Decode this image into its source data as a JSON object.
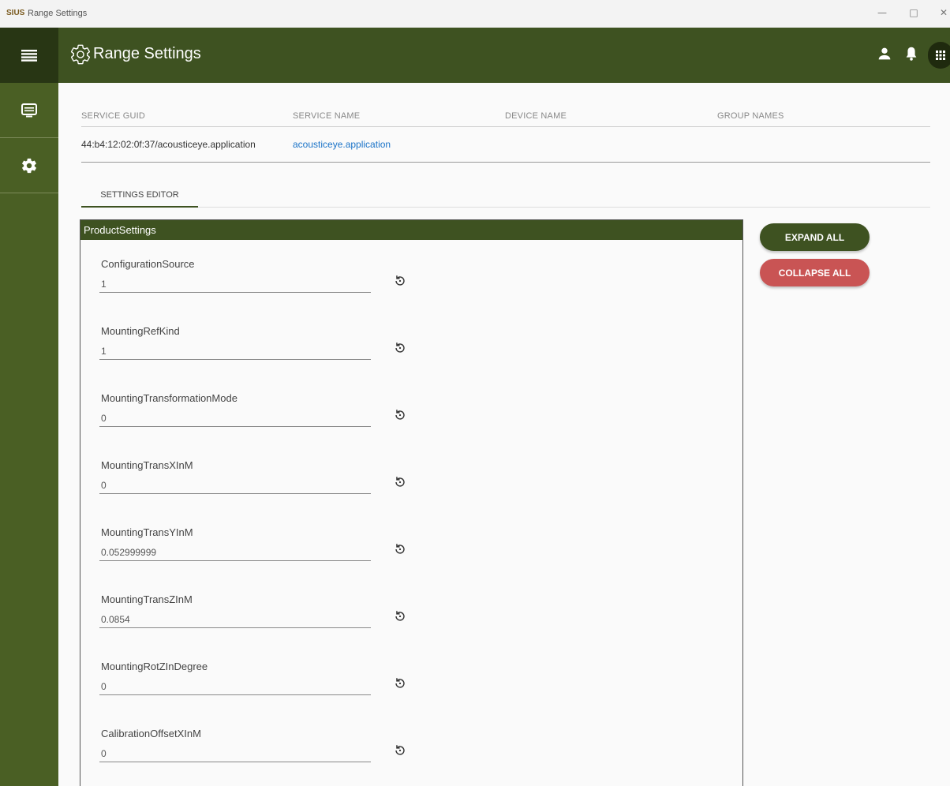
{
  "window": {
    "logo": "SIUS",
    "title": "Range Settings",
    "minimize": "—",
    "maximize": "□",
    "close": "✕"
  },
  "header": {
    "title": "Range Settings"
  },
  "service_table": {
    "columns": [
      "SERVICE GUID",
      "SERVICE NAME",
      "DEVICE NAME",
      "GROUP NAMES"
    ],
    "row": {
      "guid": "44:b4:12:02:0f:37/acousticeye.application",
      "name": "acousticeye.application"
    }
  },
  "tabs": {
    "settings_editor": "SETTINGS EDITOR"
  },
  "panel": {
    "title": "ProductSettings",
    "fields": [
      {
        "label": "ConfigurationSource",
        "value": "1"
      },
      {
        "label": "MountingRefKind",
        "value": "1"
      },
      {
        "label": "MountingTransformationMode",
        "value": "0"
      },
      {
        "label": "MountingTransXInM",
        "value": "0"
      },
      {
        "label": "MountingTransYInM",
        "value": "0.052999999"
      },
      {
        "label": "MountingTransZInM",
        "value": "0.0854"
      },
      {
        "label": "MountingRotZInDegree",
        "value": "0"
      },
      {
        "label": "CalibrationOffsetXInM",
        "value": "0"
      }
    ]
  },
  "buttons": {
    "expand_all": "EXPAND ALL",
    "collapse_all": "COLLAPSE ALL"
  },
  "colors": {
    "header": "#3e5221",
    "sidebar": "#4a5f24",
    "expand": "#3e5221",
    "collapse": "#c95454",
    "highlight": "#fff000",
    "link": "#1a73c8"
  }
}
